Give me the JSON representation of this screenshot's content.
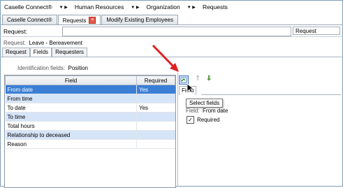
{
  "breadcrumb": [
    "Caselle Connect®",
    "Human Resources",
    "Organization",
    "Requests"
  ],
  "tabs": [
    {
      "label": "Caselle Connect®"
    },
    {
      "label": "Requests"
    },
    {
      "label": "Modify Existing Employees"
    }
  ],
  "request": {
    "label": "Request:",
    "input_value": "",
    "select_value": "Request"
  },
  "request_value": {
    "label": "Request:",
    "value": "Leave - Bereavement"
  },
  "subtabs": [
    "Request",
    "Fields",
    "Requesters"
  ],
  "identification": {
    "label": "Identification fields:",
    "value": "Position"
  },
  "grid": {
    "headers": [
      "Field",
      "Required"
    ],
    "rows": [
      {
        "field": "From date",
        "required": "Yes"
      },
      {
        "field": "From time",
        "required": ""
      },
      {
        "field": "To date",
        "required": "Yes"
      },
      {
        "field": "To time",
        "required": ""
      },
      {
        "field": "Total hours",
        "required": ""
      },
      {
        "field": "Relationship to deceased",
        "required": ""
      },
      {
        "field": "Reason",
        "required": ""
      }
    ]
  },
  "right_panel": {
    "tab_label": "Field",
    "tooltip": "Select fields",
    "field_label": "Field:",
    "field_value": "From date",
    "required_label": "Required",
    "required_checked": true
  },
  "colors": {
    "selection": "#3a7fd5",
    "alt_row": "#d6e4f7",
    "annotation_arrow": "#e02020"
  }
}
